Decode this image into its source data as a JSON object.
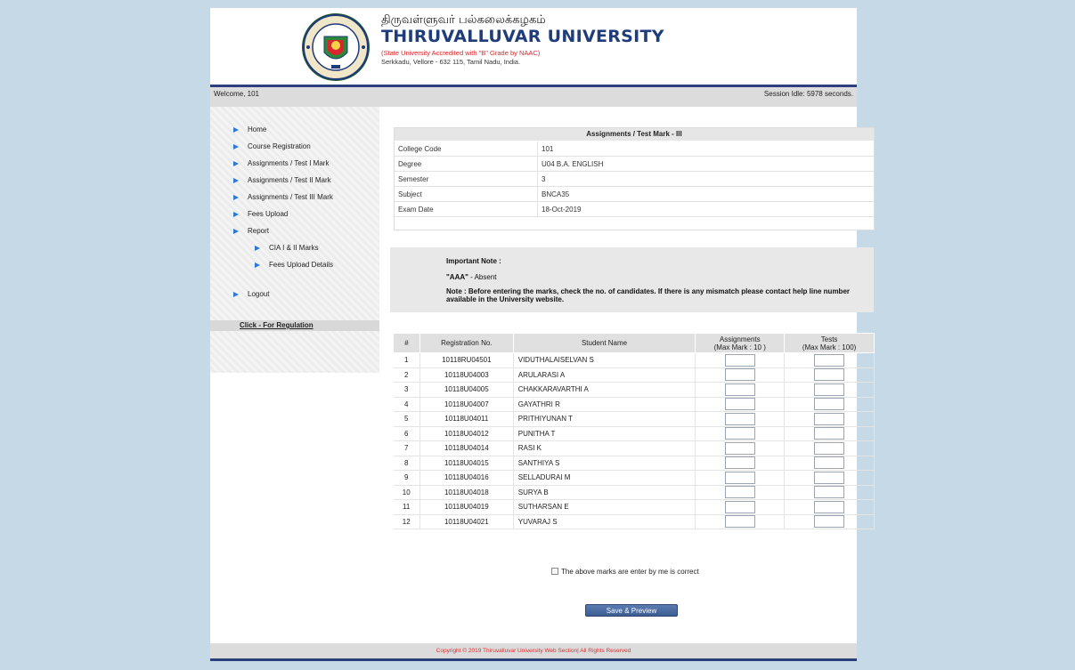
{
  "header": {
    "tamil_name": "திருவள்ளுவர் பல்கலைக்கழகம்",
    "university_name": "THIRUVALLUVAR UNIVERSITY",
    "accreditation": "(State University Accredited with \"B\" Grade by NAAC)",
    "address": "Serkkadu, Vellore - 632 115, Tamil Nadu, India.",
    "logo_icon": "university-seal-icon"
  },
  "welcome_bar": {
    "welcome": "Welcome, 101",
    "session": "Session Idle: 5978 seconds."
  },
  "sidebar": {
    "items": [
      {
        "label": "Home"
      },
      {
        "label": "Course Registration"
      },
      {
        "label": "Assignments / Test I Mark"
      },
      {
        "label": "Assignments / Test II Mark"
      },
      {
        "label": "Assignments / Test III Mark"
      },
      {
        "label": "Fees Upload"
      },
      {
        "label": "Report"
      },
      {
        "label": "CIA I & II Marks"
      },
      {
        "label": "Fees Upload Details"
      },
      {
        "label": "Logout"
      }
    ],
    "regulation_link": "Click - For Regulation"
  },
  "info": {
    "title": "Assignments / Test Mark - III",
    "rows": [
      {
        "label": "College Code",
        "value": "101"
      },
      {
        "label": "Degree",
        "value": "U04 B.A. ENGLISH"
      },
      {
        "label": "Semester",
        "value": "3"
      },
      {
        "label": "Subject",
        "value": "BNCA35"
      },
      {
        "label": "Exam Date",
        "value": "18-Oct-2019"
      }
    ]
  },
  "note": {
    "heading": "Important Note :",
    "absent_code": "\"AAA\"",
    "absent_text": " - Absent",
    "text": "Note : Before entering the marks, check the no. of candidates. If there is any mismatch please contact help line number available in the University website."
  },
  "marks_table": {
    "headers": {
      "num": "#",
      "reg": "Registration No.",
      "name": "Student Name",
      "assign": "Assignments",
      "assign_max": "(Max Mark : 10 )",
      "tests": "Tests",
      "tests_max": "(Max Mark : 100)"
    },
    "rows": [
      {
        "num": "1",
        "reg": "10118RU04501",
        "name": "VIDUTHALAISELVAN S"
      },
      {
        "num": "2",
        "reg": "10118U04003",
        "name": "ARULARASI A"
      },
      {
        "num": "3",
        "reg": "10118U04005",
        "name": "CHAKKARAVARTHI A"
      },
      {
        "num": "4",
        "reg": "10118U04007",
        "name": "GAYATHRI R"
      },
      {
        "num": "5",
        "reg": "10118U04011",
        "name": "PRITHIYUNAN T"
      },
      {
        "num": "6",
        "reg": "10118U04012",
        "name": "PUNITHA T"
      },
      {
        "num": "7",
        "reg": "10118U04014",
        "name": "RASI K"
      },
      {
        "num": "8",
        "reg": "10118U04015",
        "name": "SANTHIYA S"
      },
      {
        "num": "9",
        "reg": "10118U04016",
        "name": "SELLADURAI M"
      },
      {
        "num": "10",
        "reg": "10118U04018",
        "name": "SURYA B"
      },
      {
        "num": "11",
        "reg": "10118U04019",
        "name": "SUTHARSAN E"
      },
      {
        "num": "12",
        "reg": "10118U04021",
        "name": "YUVARAJ S"
      }
    ]
  },
  "confirm_label": "The above marks are enter by me is correct",
  "save_button": "Save & Preview",
  "footer": "Copyright © 2019 Thiruvalluvar University Web Section| All Rights Reserved",
  "colors": {
    "brand_navy": "#2a3f7c",
    "accent_red": "#d8262c",
    "nav_arrow": "#2b78d6",
    "page_bg": "#c5d9e6"
  }
}
